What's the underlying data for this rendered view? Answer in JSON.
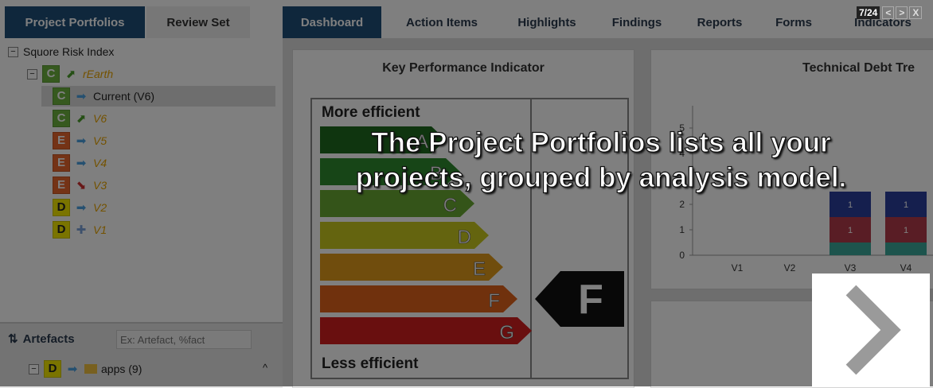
{
  "left_tabs": {
    "portfolios": "Project Portfolios",
    "review": "Review Set"
  },
  "tree": {
    "root": "Squore Risk Index",
    "project": {
      "badge": "C",
      "label": "rEarth",
      "trend": "up"
    },
    "versions": [
      {
        "badge": "C",
        "label": "Current (V6)",
        "trend": "stable",
        "selected": true,
        "color": "#6cb33e"
      },
      {
        "badge": "C",
        "label": "V6",
        "trend": "up",
        "selected": false,
        "color": "#6cb33e"
      },
      {
        "badge": "E",
        "label": "V5",
        "trend": "stable",
        "selected": false,
        "color": "#e8662c"
      },
      {
        "badge": "E",
        "label": "V4",
        "trend": "stable",
        "selected": false,
        "color": "#e8662c"
      },
      {
        "badge": "E",
        "label": "V3",
        "trend": "down",
        "selected": false,
        "color": "#e8662c"
      },
      {
        "badge": "D",
        "label": "V2",
        "trend": "stable",
        "selected": false,
        "color": "#f4e800"
      },
      {
        "badge": "D",
        "label": "V1",
        "trend": "new",
        "selected": false,
        "color": "#f4e800"
      }
    ]
  },
  "artefacts": {
    "title": "Artefacts",
    "search_placeholder": "Ex: Artefact, %fact",
    "item": {
      "badge": "D",
      "label": "apps (9)"
    }
  },
  "right_tabs": [
    "Dashboard",
    "Action Items",
    "Highlights",
    "Findings",
    "Reports",
    "Forms",
    "Indicators"
  ],
  "kpi": {
    "title": "Key Performance Indicator",
    "top_label": "More efficient",
    "bottom_label": "Less efficient",
    "grades": [
      "A",
      "B",
      "C",
      "D",
      "E",
      "F",
      "G"
    ],
    "grade_colors": [
      "#1e6b1e",
      "#2f8a2f",
      "#69a832",
      "#c8c81e",
      "#e09a1a",
      "#e0621a",
      "#d21e1e"
    ],
    "current": "F"
  },
  "tech_debt": {
    "title": "Technical Debt Tre",
    "y_ticks": [
      "5",
      "4",
      "3",
      "2",
      "1",
      "0"
    ],
    "x_labels": [
      "V1",
      "V2",
      "V3",
      "V4"
    ],
    "bar_label": "1"
  },
  "tour": {
    "counter": "7/24",
    "prev": "<",
    "next": ">",
    "close": "X",
    "message_line1": "The Project Portfolios lists all your",
    "message_line2": "projects, grouped by analysis model."
  }
}
